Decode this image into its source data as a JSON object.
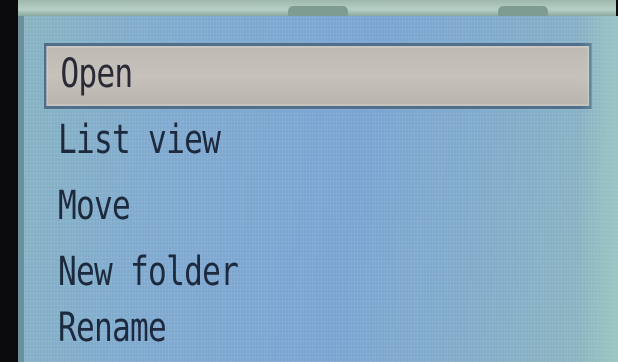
{
  "menu": {
    "items": [
      {
        "label": "Open",
        "selected": true
      },
      {
        "label": "List view",
        "selected": false
      },
      {
        "label": "Move",
        "selected": false
      },
      {
        "label": "New folder",
        "selected": false
      },
      {
        "label": "Rename",
        "selected": false
      }
    ]
  },
  "colors": {
    "panel_background": "#7fa9cf",
    "highlight_background": "#c7c1bc",
    "highlight_border": "#4f6f8a",
    "text": "#1d2a3e"
  }
}
